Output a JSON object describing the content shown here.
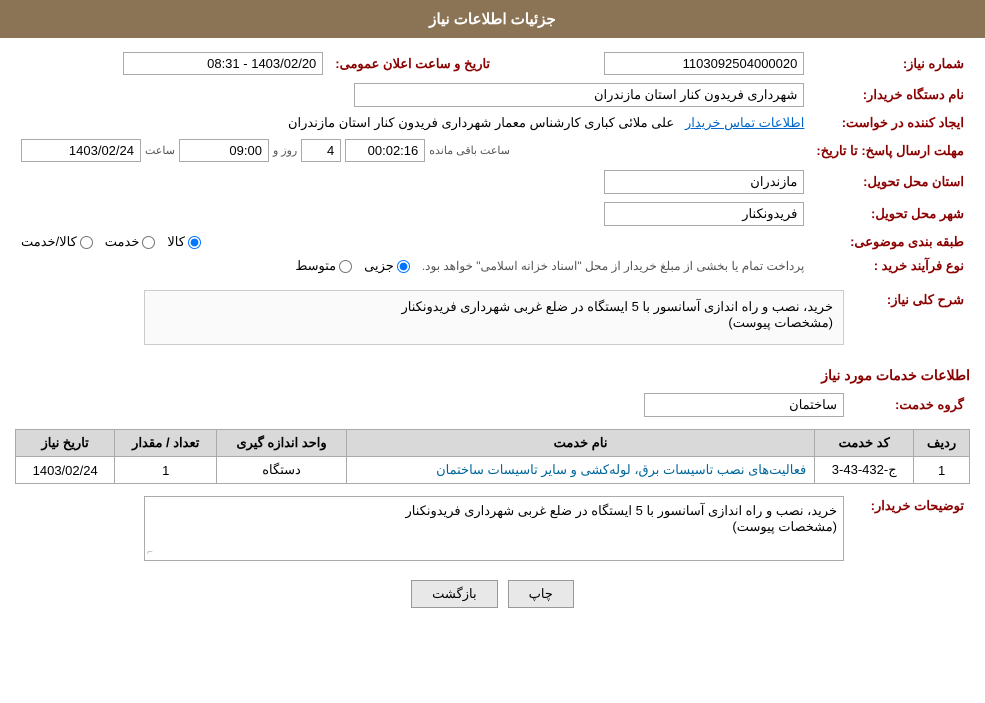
{
  "header": {
    "title": "جزئیات اطلاعات نیاز"
  },
  "fields": {
    "need_number_label": "شماره نیاز:",
    "need_number_value": "1103092504000020",
    "announcement_datetime_label": "تاریخ و ساعت اعلان عمومی:",
    "announcement_datetime_value": "1403/02/20 - 08:31",
    "requester_org_label": "نام دستگاه خریدار:",
    "requester_org_value": "شهرداری فریدون کنار استان مازندران",
    "creator_label": "ایجاد کننده در خواست:",
    "creator_value": "علی ملائی کباری کارشناس معمار شهرداری فریدون کنار استان مازندران",
    "creator_link": "اطلاعات تماس خریدار",
    "send_deadline_label": "مهلت ارسال پاسخ: تا تاریخ:",
    "send_deadline_date": "1403/02/24",
    "send_deadline_time_label": "ساعت",
    "send_deadline_time": "09:00",
    "send_deadline_days_label": "روز و",
    "send_deadline_days": "4",
    "send_deadline_remaining_label": "ساعت باقی مانده",
    "send_deadline_remaining": "00:02:16",
    "delivery_province_label": "استان محل تحویل:",
    "delivery_province_value": "مازندران",
    "delivery_city_label": "شهر محل تحویل:",
    "delivery_city_value": "فریدونکنار",
    "category_label": "طبقه بندی موضوعی:",
    "category_goods": "کالا",
    "category_service": "خدمت",
    "category_goods_service": "کالا/خدمت",
    "purchase_type_label": "نوع فرآیند خرید :",
    "purchase_type_partial": "جزیی",
    "purchase_type_medium": "متوسط",
    "purchase_type_note": "پرداخت تمام یا بخشی از مبلغ خریدار از محل \"اسناد خزانه اسلامی\" خواهد بود.",
    "need_desc_label": "شرح کلی نیاز:",
    "need_desc_value": "خرید، نصب و راه اندازی آسانسور با 5 ایستگاه در ضلع غربی شهرداری فریدونکنار",
    "need_desc_sub": "(مشخصات پیوست)",
    "services_section_label": "اطلاعات خدمات مورد نیاز",
    "service_group_label": "گروه خدمت:",
    "service_group_value": "ساختمان",
    "table": {
      "col_row": "ردیف",
      "col_code": "کد خدمت",
      "col_name": "نام خدمت",
      "col_unit": "واحد اندازه گیری",
      "col_qty": "تعداد / مقدار",
      "col_date": "تاریخ نیاز",
      "rows": [
        {
          "row": "1",
          "code": "ج-432-43-3",
          "name": "فعالیت‌های نصب تاسیسات برق، لوله‌کشی و سایر تاسیسات ساختمان",
          "unit": "دستگاه",
          "qty": "1",
          "date": "1403/02/24"
        }
      ]
    },
    "buyer_notes_label": "توضیحات خریدار:",
    "buyer_notes_value": "خرید، نصب و راه اندازی آسانسور با 5 ایستگاه در ضلع غربی شهرداری فریدونکنار",
    "buyer_notes_sub": "(مشخصات پیوست)"
  },
  "buttons": {
    "print": "چاپ",
    "back": "بازگشت"
  }
}
